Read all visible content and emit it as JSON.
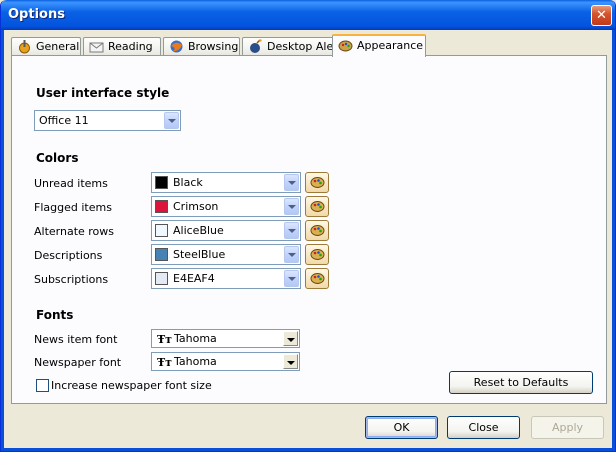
{
  "window": {
    "title": "Options",
    "close_glyph": "✕"
  },
  "tabs": [
    {
      "label": "General",
      "icon": "general-icon"
    },
    {
      "label": "Reading",
      "icon": "envelope-icon"
    },
    {
      "label": "Browsing",
      "icon": "browser-icon"
    },
    {
      "label": "Desktop Alert",
      "icon": "alert-bomb-icon"
    },
    {
      "label": "Appearance",
      "icon": "palette-icon",
      "active": true
    }
  ],
  "ui_style": {
    "heading": "User interface style",
    "value": "Office 11"
  },
  "colors": {
    "heading": "Colors",
    "rows": [
      {
        "label": "Unread items",
        "value": "Black",
        "swatch": "#000000"
      },
      {
        "label": "Flagged items",
        "value": "Crimson",
        "swatch": "#dc143c"
      },
      {
        "label": "Alternate rows",
        "value": "AliceBlue",
        "swatch": "#f0f8ff"
      },
      {
        "label": "Descriptions",
        "value": "SteelBlue",
        "swatch": "#4682b4"
      },
      {
        "label": "Subscriptions",
        "value": "E4EAF4",
        "swatch": "#e4eaf4"
      }
    ]
  },
  "fonts": {
    "heading": "Fonts",
    "news_item_label": "News item font",
    "news_item_value": "Tahoma",
    "newspaper_label": "Newspaper font",
    "newspaper_value": "Tahoma",
    "font_glyph": "Ŧт",
    "increase_label": "Increase newspaper font size",
    "increase_checked": false
  },
  "buttons": {
    "reset": "Reset to Defaults",
    "ok": "OK",
    "close": "Close",
    "apply": "Apply"
  }
}
